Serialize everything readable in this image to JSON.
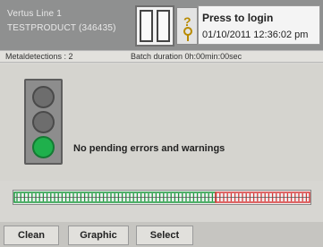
{
  "header": {
    "line_name": "Vertus Line 1",
    "product_name": "TESTPRODUCT (346435)",
    "login_title": "Press to login",
    "datetime": "01/10/2011 12:36:02 pm"
  },
  "status": {
    "metal_detections": "Metaldetections : 2",
    "batch_duration": "Batch duration   0h:00min:00sec"
  },
  "main": {
    "message": "No pending errors and warnings",
    "traffic_light_active": "green"
  },
  "progress": {
    "green_fraction": 0.68,
    "colors": {
      "good": "#1a9a3d",
      "bad": "#d83838"
    }
  },
  "buttons": {
    "clean": "Clean",
    "graphic": "Graphic",
    "select": "Select"
  },
  "icons": [
    "document-panels-icon",
    "key-question-icon"
  ]
}
